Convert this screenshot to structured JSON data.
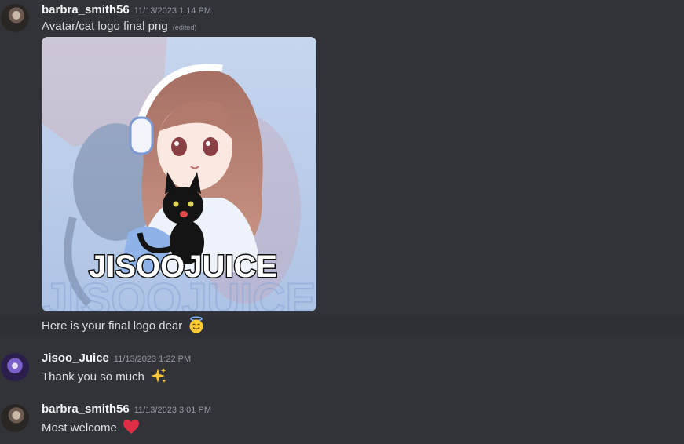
{
  "messages": [
    {
      "username": "barbra_smith56",
      "timestamp": "11/13/2023 1:14 PM",
      "text": "Avatar/cat logo final png",
      "edited_label": "(edited)",
      "attachment": {
        "kind": "image",
        "logo_text": "JISOOJUICE"
      },
      "followup_text": "Here is your final logo dear",
      "followup_emoji": "smiling-face-with-halo-emoji"
    },
    {
      "username": "Jisoo_Juice",
      "timestamp": "11/13/2023 1:22 PM",
      "text": "Thank you so much",
      "emoji": "sparkles-emoji"
    },
    {
      "username": "barbra_smith56",
      "timestamp": "11/13/2023 3:01 PM",
      "text": "Most welcome",
      "emoji": "red-heart-emoji"
    }
  ],
  "colors": {
    "background": "#313338",
    "username": "#f2f3f5",
    "timestamp": "#949ba4",
    "text": "#dbdee1",
    "hover_row": "#2e3035"
  }
}
